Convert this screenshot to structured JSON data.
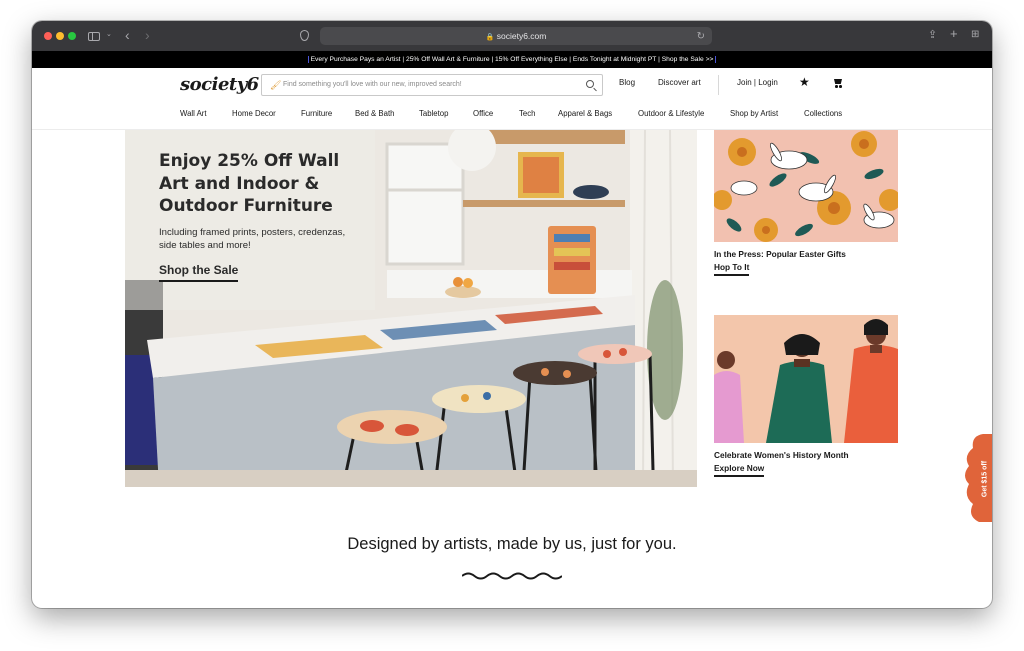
{
  "browser": {
    "url": "society6.com"
  },
  "promo": {
    "text": "Every Purchase Pays an Artist | 25% Off Wall Art & Furniture | 15% Off Everything Else | Ends Tonight at Midnight PT | Shop the Sale >>"
  },
  "header": {
    "logo": "society6",
    "search_placeholder": "Find something you'll love with our new, improved search!",
    "links": {
      "blog": "Blog",
      "discover": "Discover art",
      "account": "Join | Login"
    }
  },
  "nav": {
    "items": [
      "Wall Art",
      "Home Decor",
      "Furniture",
      "Bed & Bath",
      "Tabletop",
      "Office",
      "Tech",
      "Apparel & Bags",
      "Outdoor & Lifestyle",
      "Shop by Artist",
      "Collections"
    ]
  },
  "hero": {
    "title": "Enjoy 25% Off Wall Art and Indoor & Outdoor Furniture",
    "subtitle": "Including framed prints, posters, credenzas, side tables and more!",
    "cta": "Shop the Sale"
  },
  "cards": [
    {
      "title": "In the Press: Popular Easter Gifts",
      "cta": "Hop To It"
    },
    {
      "title": "Celebrate Women's History Month",
      "cta": "Explore Now"
    }
  ],
  "tagline": "Designed by artists, made by us, just for you.",
  "side_tab": {
    "label": "Get $15 off"
  },
  "colors": {
    "chrome": "#38383b",
    "promo_bg": "#000000",
    "side_tab": "#e0643a"
  },
  "icons": [
    "sidebar-icon",
    "back-icon",
    "forward-icon",
    "shield-icon",
    "lock-icon",
    "reload-icon",
    "share-icon",
    "new-tab-icon",
    "tab-overview-icon",
    "paintbrush-icon",
    "search-icon",
    "star-icon",
    "cart-icon"
  ]
}
